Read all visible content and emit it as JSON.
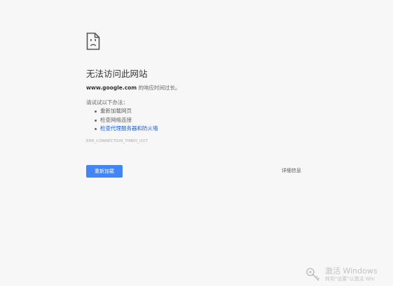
{
  "error_page": {
    "title": "无法访问此网站",
    "host": "www.google.com",
    "summary_suffix": " 的响应时间过长。",
    "suggestions_label": "请试试以下办法：",
    "suggestions": [
      "重新加载网页",
      "检查网络连接",
      "检查代理服务器和防火墙"
    ],
    "error_code": "ERR_CONNECTION_TIMED_OUT",
    "reload_label": "重新加载",
    "details_label": "详细信息"
  },
  "watermark": {
    "title": "激活 Windows",
    "subtitle": "转到\"设置\"以激活 Win"
  },
  "icons": {
    "error": "sad-document-icon",
    "watermark": "key-icon"
  },
  "colors": {
    "background": "#f7f7f7",
    "primary_button": "#4285f4",
    "link": "#1a5fd6",
    "title_text": "#333333",
    "body_text": "#646464",
    "code_text": "#a8a8a8"
  }
}
